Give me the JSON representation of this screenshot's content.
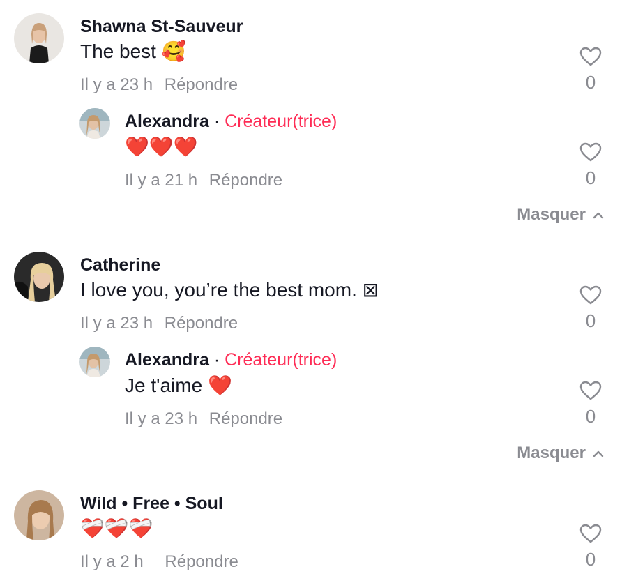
{
  "comments": [
    {
      "author": "Shawna St-Sauveur",
      "text": "The best 🥰",
      "time": "Il y a 23 h",
      "reply_label": "Répondre",
      "likes": "0",
      "replies": [
        {
          "author": "Alexandra",
          "separator": "·",
          "badge": "Créateur(trice)",
          "text": "❤️❤️❤️",
          "time": "Il y a 21 h",
          "reply_label": "Répondre",
          "likes": "0"
        }
      ],
      "toggle_label": "Masquer"
    },
    {
      "author": "Catherine",
      "text": "I love you, you’re the best mom. ⊠",
      "time": "Il y a 23 h",
      "reply_label": "Répondre",
      "likes": "0",
      "replies": [
        {
          "author": "Alexandra",
          "separator": "·",
          "badge": "Créateur(trice)",
          "text": "Je t'aime ❤️",
          "time": "Il y a 23 h",
          "reply_label": "Répondre",
          "likes": "0"
        }
      ],
      "toggle_label": "Masquer"
    },
    {
      "author": "Wild • Free • Soul",
      "text": "❤️‍🩹❤️‍🩹❤️‍🩹",
      "time": "Il y a 2 h",
      "reply_label": "Répondre",
      "likes": "0"
    }
  ],
  "colors": {
    "creator_badge": "#fe2c55",
    "meta_text": "#8a8b91",
    "heart_red": "#e0242f"
  }
}
